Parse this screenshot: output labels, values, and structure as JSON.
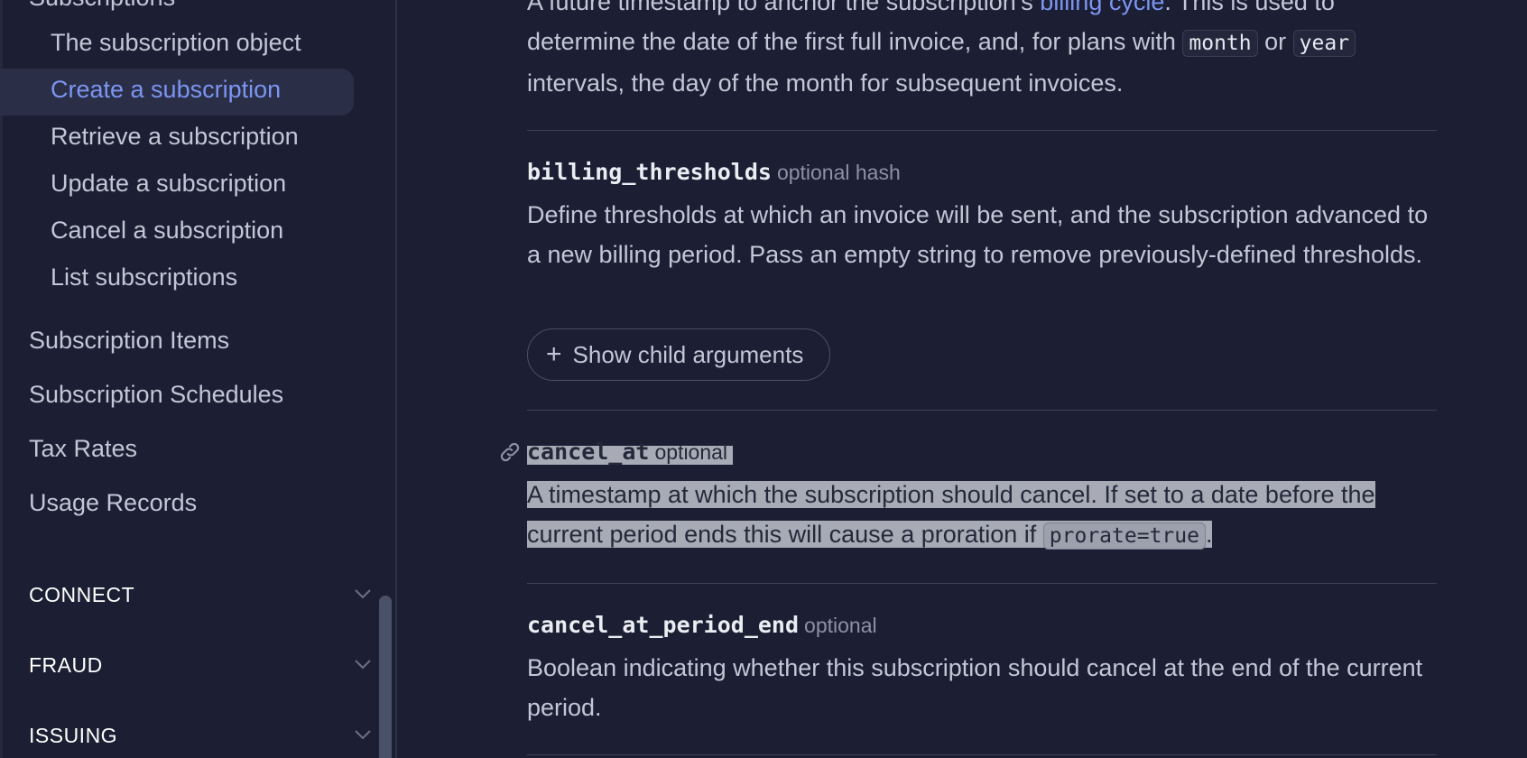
{
  "sidebar": {
    "group_title": "Subscriptions",
    "sub_items": [
      {
        "label": "The subscription object"
      },
      {
        "label": "Create a subscription"
      },
      {
        "label": "Retrieve a subscription"
      },
      {
        "label": "Update a subscription"
      },
      {
        "label": "Cancel a subscription"
      },
      {
        "label": "List subscriptions"
      }
    ],
    "active_sub_item": "Create a subscription",
    "sections": [
      {
        "label": "Subscription Items"
      },
      {
        "label": "Subscription Schedules"
      },
      {
        "label": "Tax Rates"
      },
      {
        "label": "Usage Records"
      }
    ],
    "categories": [
      {
        "label": "CONNECT",
        "icon": "chevron-down-icon"
      },
      {
        "label": "FRAUD",
        "icon": "chevron-down-icon"
      },
      {
        "label": "ISSUING",
        "icon": "chevron-down-icon"
      }
    ]
  },
  "content": {
    "billing_cycle_anchor": {
      "text_before": "A future timestamp to anchor the subscription’s ",
      "link": "billing cycle",
      "text_mid1": ". This is used to determine the date of the first full invoice, and, for plans with ",
      "code1": "month",
      "text_mid2": " or ",
      "code2": "year",
      "text_after": " intervals, the day of the month for subsequent invoices."
    },
    "params": [
      {
        "name": "billing_thresholds",
        "type": "optional hash",
        "description": "Define thresholds at which an invoice will be sent, and the subscription advanced to a new billing period. Pass an empty string to remove previously-defined thresholds.",
        "button_label": "Show child arguments"
      },
      {
        "name": "cancel_at",
        "type": "optional",
        "description_before": "A timestamp at which the subscription should cancel. If set to a date before the current period ends this will cause a proration if ",
        "code": "prorate=true",
        "description_after": "."
      },
      {
        "name": "cancel_at_period_end",
        "type": "optional",
        "description": "Boolean indicating whether this subscription should cancel at the end of the current period."
      }
    ]
  },
  "colors": {
    "background": "#1c1f33",
    "accent_link": "#7c95f2",
    "highlight": "#a8abb6"
  }
}
